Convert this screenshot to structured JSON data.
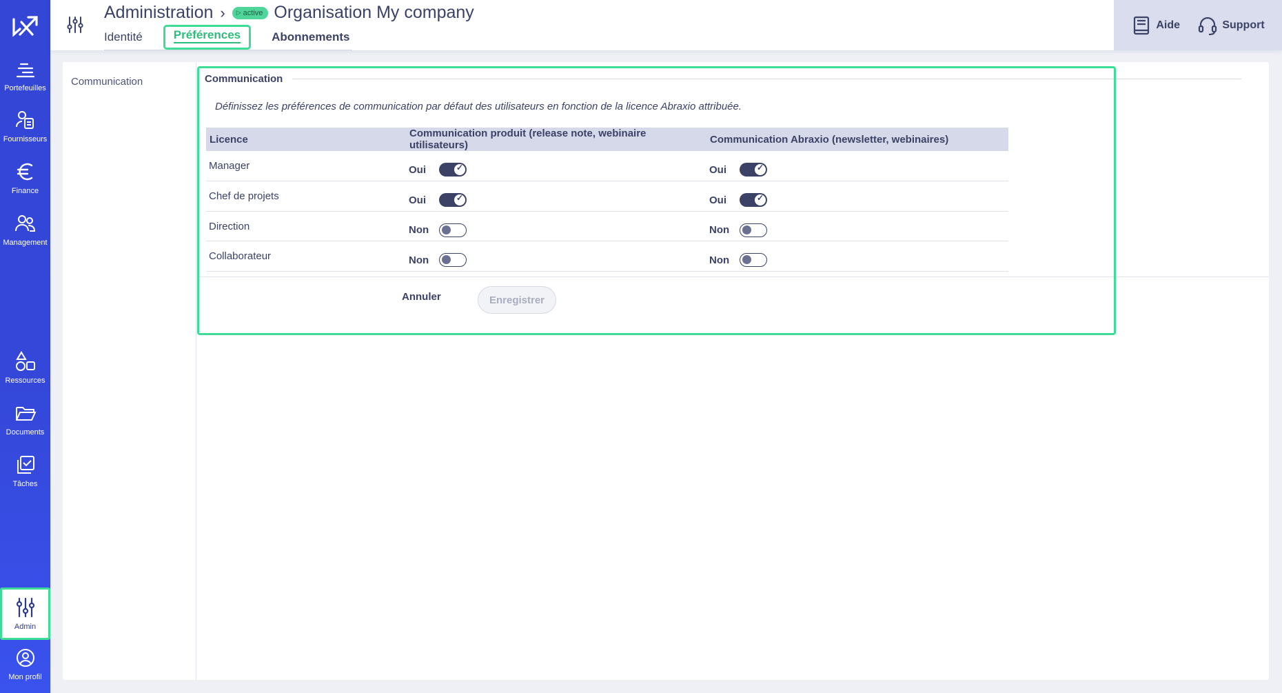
{
  "sidebar": {
    "items": [
      {
        "label": "Portefeuilles",
        "icon": "portfolio-icon"
      },
      {
        "label": "Fournisseurs",
        "icon": "suppliers-icon"
      },
      {
        "label": "Finance",
        "icon": "euro-icon"
      },
      {
        "label": "Management",
        "icon": "users-icon"
      },
      {
        "label": "Ressources",
        "icon": "shapes-icon"
      },
      {
        "label": "Documents",
        "icon": "folder-icon"
      },
      {
        "label": "Tâches",
        "icon": "tasks-icon"
      },
      {
        "label": "Admin",
        "icon": "sliders-icon"
      },
      {
        "label": "Mon profil",
        "icon": "profile-icon"
      }
    ]
  },
  "header": {
    "title": "Administration",
    "badge": "active",
    "org": "Organisation My company",
    "tabs": [
      {
        "label": "Identité"
      },
      {
        "label": "Préférences"
      },
      {
        "label": "Abonnements"
      }
    ],
    "help_label": "Aide",
    "support_label": "Support"
  },
  "side_section": "Communication",
  "section": {
    "legend": "Communication",
    "description": "Définissez les préférences de communication par défaut des utilisateurs en fonction de la licence Abraxio attribuée.",
    "columns": [
      "Licence",
      "Communication produit (release note, webinaire utilisateurs)",
      "Communication Abraxio (newsletter, webinaires)"
    ],
    "rows": [
      {
        "licence": "Manager",
        "product_text": "Oui",
        "product_on": true,
        "abraxio_text": "Oui",
        "abraxio_on": true
      },
      {
        "licence": "Chef de projets",
        "product_text": "Oui",
        "product_on": true,
        "abraxio_text": "Oui",
        "abraxio_on": true
      },
      {
        "licence": "Direction",
        "product_text": "Non",
        "product_on": false,
        "abraxio_text": "Non",
        "abraxio_on": false
      },
      {
        "licence": "Collaborateur",
        "product_text": "Non",
        "product_on": false,
        "abraxio_text": "Non",
        "abraxio_on": false
      }
    ],
    "cancel_label": "Annuler",
    "save_label": "Enregistrer"
  },
  "colors": {
    "accent": "#3ddc97",
    "sidebar": "#3447d8",
    "text": "#3b4266"
  }
}
